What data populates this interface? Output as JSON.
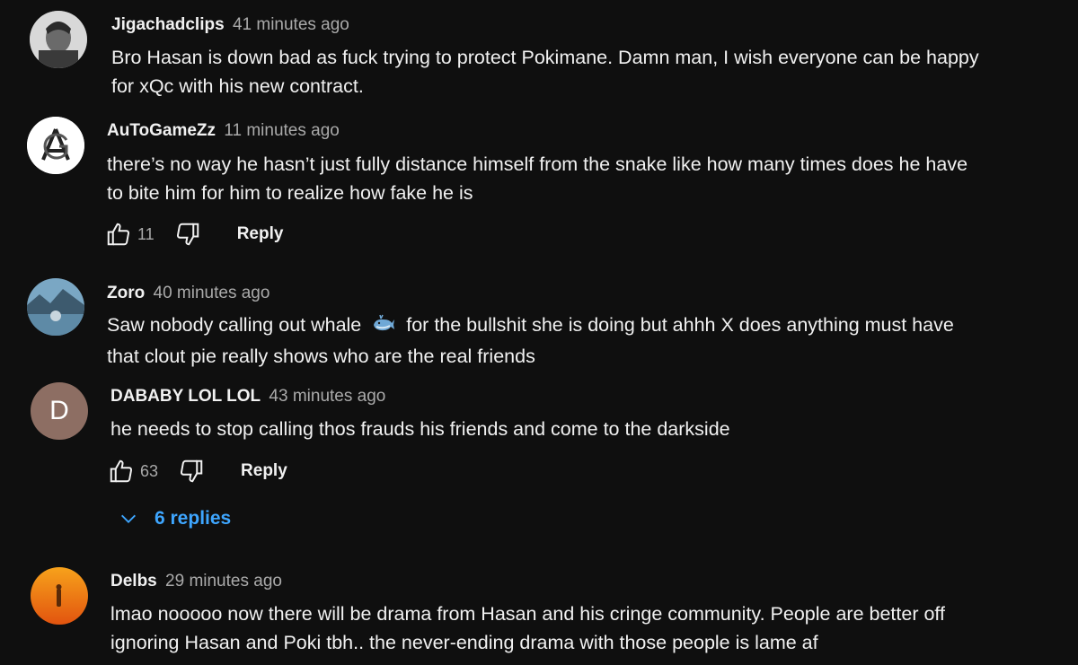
{
  "comments": [
    {
      "author": "Jigachadclips",
      "time": "41 minutes ago",
      "lines": [
        "Bro Hasan is down bad as fuck trying to protect Pokimane. Damn man, I wish everyone can be happy",
        "for xQc with his new contract."
      ]
    },
    {
      "author": "AuToGameZz",
      "time": "11 minutes ago",
      "lines": [
        "there’s no way he hasn’t just fully distance himself from the snake like how many times does he have",
        "to bite him for him to realize how fake he is"
      ],
      "likes": "11",
      "reply_label": "Reply"
    },
    {
      "author": "Zoro",
      "time": "40 minutes ago",
      "lines_a": "Saw nobody calling out whale",
      "lines_b": "for the bullshit she is doing but ahhh X does anything must have",
      "line2": "that clout pie really shows who are the real friends"
    },
    {
      "author": "DABABY LOL LOL",
      "time": "43 minutes ago",
      "avatar_letter": "D",
      "lines": [
        "he needs to stop calling thos frauds his friends and come to the darkside"
      ],
      "likes": "63",
      "reply_label": "Reply",
      "replies_label": "6 replies"
    },
    {
      "author": "Delbs",
      "time": "29 minutes ago",
      "lines": [
        "lmao nooooo now there will be drama from Hasan and his cringe community. People are better off",
        "ignoring Hasan and Poki tbh.. the never-ending drama with those people is lame af"
      ]
    }
  ],
  "colors": {
    "background": "#0f0f0f",
    "link": "#3ea6ff",
    "muted": "#aaaaaa",
    "text": "#f1f1f1"
  }
}
